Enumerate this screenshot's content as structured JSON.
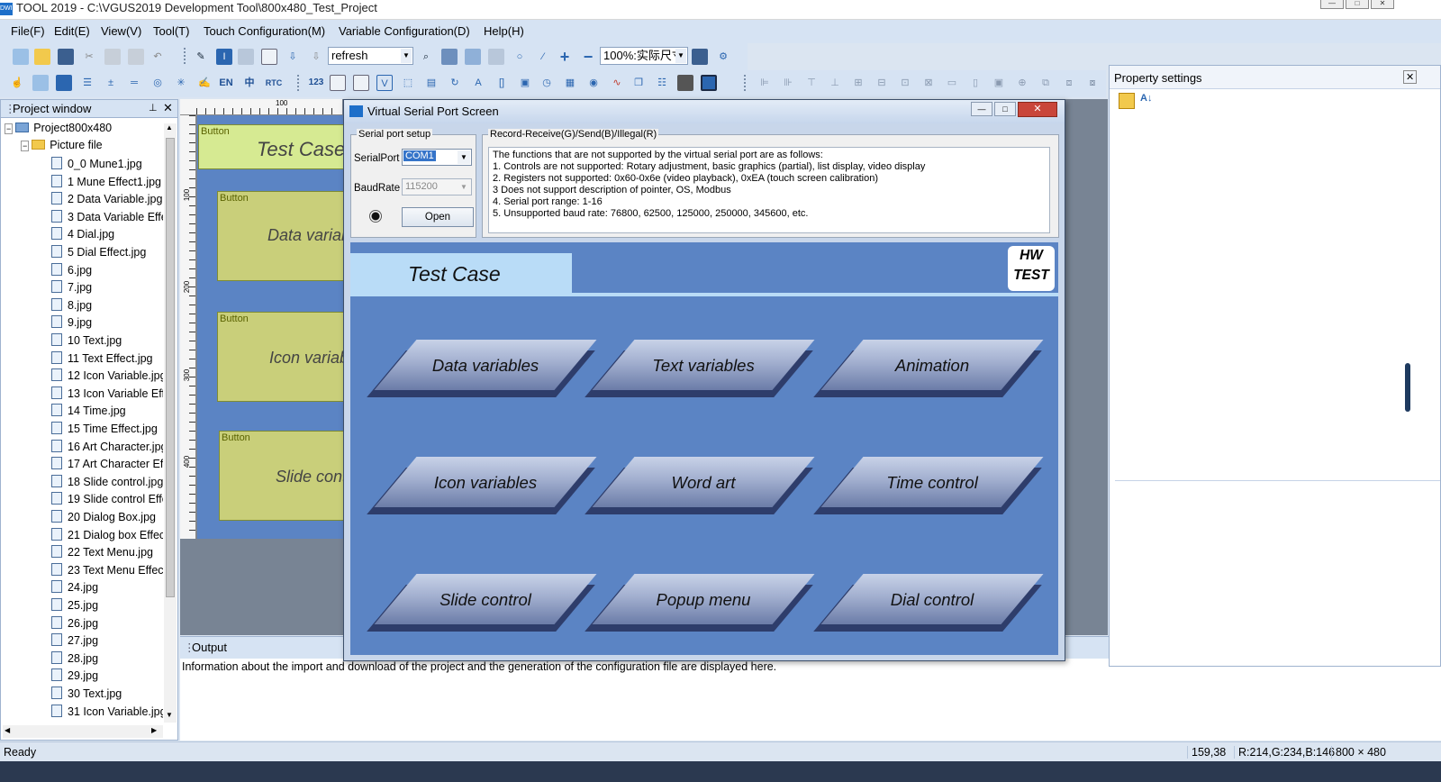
{
  "titlebar": {
    "title": "TOOL 2019 - C:\\VGUS2019 Development Tool\\800x480_Test_Project",
    "icon_text": "DWIN"
  },
  "menu": [
    "File(F)",
    "Edit(E)",
    "View(V)",
    "Tool(T)",
    "Touch Configuration(M)",
    "Variable Configuration(D)",
    "Help(H)"
  ],
  "toolbar": {
    "refresh_value": "refresh",
    "zoom_value": "100%:实际尺寸",
    "icon_labels": [
      "EN",
      "中",
      "RTC",
      "123"
    ]
  },
  "project_window": {
    "title": "Project window",
    "root": "Project800x480",
    "folder": "Picture file",
    "files": [
      "0_0 Mune1.jpg",
      "1 Mune Effect1.jpg",
      "2 Data Variable.jpg",
      "3 Data Variable Effect.jpg",
      "4 Dial.jpg",
      "5 Dial Effect.jpg",
      "6.jpg",
      "7.jpg",
      "8.jpg",
      "9.jpg",
      "10 Text.jpg",
      "11 Text Effect.jpg",
      "12 Icon Variable.jpg",
      "13 Icon Variable Effect.jpg",
      "14 Time.jpg",
      "15 Time Effect.jpg",
      "16 Art Character.jpg",
      "17 Art Character Effect.jpg",
      "18 Slide control.jpg",
      "19 Slide control Effect.jpg",
      "20 Dialog Box.jpg",
      "21 Dialog box Effect.jpg",
      "22 Text Menu.jpg",
      "23 Text Menu Effect.jpg",
      "24.jpg",
      "25.jpg",
      "26.jpg",
      "27.jpg",
      "28.jpg",
      "29.jpg",
      "30 Text.jpg",
      "31 Icon Variable.jpg"
    ]
  },
  "canvas": {
    "ruler_marks": [
      "100",
      "100",
      "200",
      "300",
      "400"
    ],
    "buttons": [
      {
        "label": "Button",
        "text": "Test Case"
      },
      {
        "label": "Button",
        "text": "Data variables"
      },
      {
        "label": "Button",
        "text": "Icon variables"
      },
      {
        "label": "Button",
        "text": "Slide control"
      }
    ]
  },
  "dialog": {
    "title": "Virtual Serial Port Screen",
    "serial_group": "Serial port setup",
    "serialport_label": "SerialPort",
    "serialport_value": "COM1",
    "baudrate_label": "BaudRate",
    "baudrate_value": "115200",
    "open_button": "Open",
    "record_group": "Record-Receive(G)/Send(B)/Illegal(R)",
    "record_lines": [
      "The functions that are not supported by the virtual serial port are as follows:",
      "1. Controls are not supported: Rotary adjustment, basic graphics (partial), list display, video display",
      "2. Registers not supported: 0x60-0x6e (video playback), 0xEA (touch screen calibration)",
      "3 Does not support description of pointer, OS, Modbus",
      "4. Serial port range: 1-16",
      "5. Unsupported baud rate: 76800, 62500, 125000, 250000, 345600, etc."
    ],
    "hmi": {
      "header": "Test Case",
      "badge_line1": "HW",
      "badge_line2": "TEST",
      "buttons": [
        "Data variables",
        "Text variables",
        "Animation",
        "Icon variables",
        "Word art",
        "Time control",
        "Slide control",
        "Popup menu",
        "Dial control"
      ]
    }
  },
  "output": {
    "title": "Output",
    "message": "Information about the import and download of the project and the generation of the configuration file are displayed here."
  },
  "property": {
    "title": "Property settings"
  },
  "status": {
    "ready": "Ready",
    "coords": "159,38",
    "color": "R:214,G:234,B:146",
    "resolution": "800 × 480"
  }
}
